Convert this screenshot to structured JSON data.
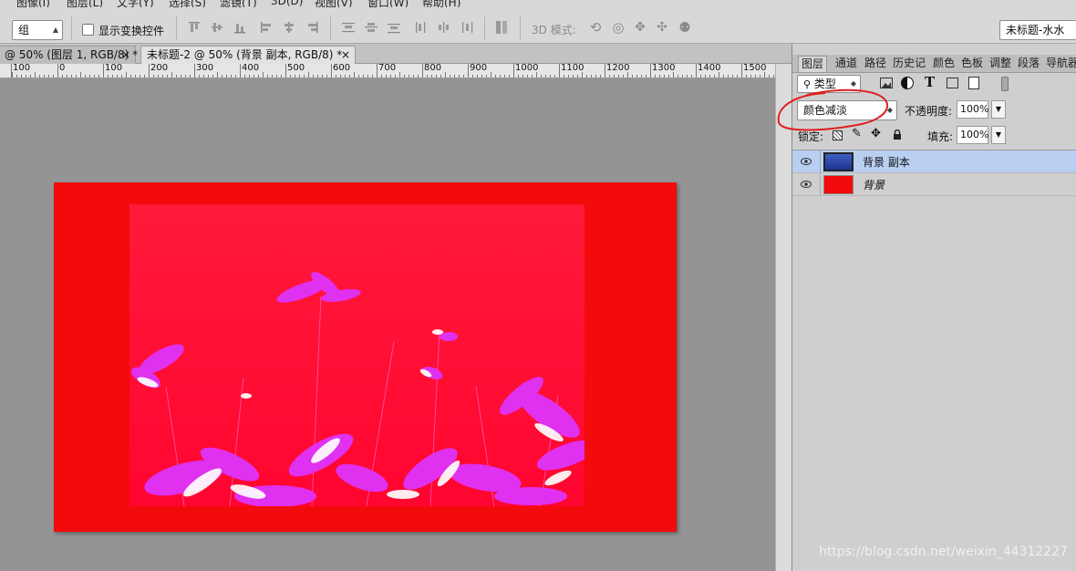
{
  "menubar": {
    "items": [
      "图像(I)",
      "图层(L)",
      "文字(Y)",
      "选择(S)",
      "滤镜(T)",
      "3D(D)",
      "视图(V)",
      "窗口(W)",
      "帮助(H)"
    ]
  },
  "options": {
    "auto_select_value": "组",
    "show_transform_label": "显示变换控件",
    "mode_3d_label": "3D 模式:",
    "workspace_value": "未标题-水水"
  },
  "tabs": [
    {
      "label": "@ 50% (图层 1, RGB/8) *",
      "close": "×",
      "active": false
    },
    {
      "label": "未标题-2 @ 50% (背景 副本, RGB/8) *",
      "close": "×",
      "active": true
    }
  ],
  "ruler": {
    "ticks": [
      "100",
      "0",
      "100",
      "200",
      "300",
      "400",
      "500",
      "600",
      "700",
      "800",
      "900",
      "1000",
      "1100",
      "1200",
      "1300",
      "1400",
      "1500"
    ]
  },
  "layers_panel": {
    "tabs": [
      "图层",
      "通道",
      "路径",
      "历史记",
      "颜色",
      "色板",
      "调整",
      "段落",
      "导航器"
    ],
    "filter_value": "类型",
    "blend_mode": "颜色减淡",
    "opacity_label": "不透明度:",
    "opacity_value": "100%",
    "lock_label": "锁定:",
    "fill_label": "填充:",
    "fill_value": "100%",
    "layers": [
      {
        "name": "背景 副本",
        "selected": true
      },
      {
        "name": "背景",
        "selected": false
      }
    ]
  },
  "canvas": {
    "artboard_color": "#f30a0a",
    "photo_color": "#ff0d33",
    "flower_color": "#e020e8"
  },
  "annotation": {
    "color": "#e02020"
  },
  "watermark": "https://blog.csdn.net/weixin_44312227"
}
